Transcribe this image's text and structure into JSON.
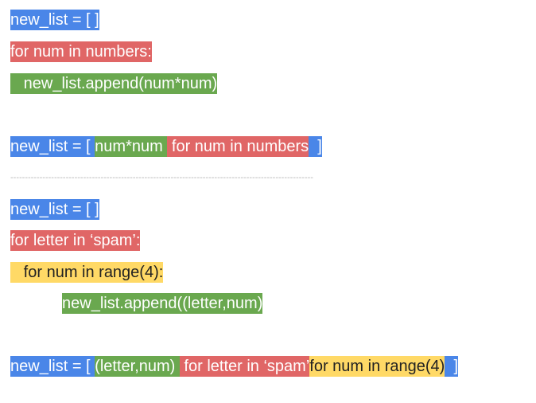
{
  "colors": {
    "blue": "#4a86e8",
    "red": "#e06666",
    "green": "#6aa84f",
    "yellow": "#ffd966"
  },
  "section1": {
    "init": "new_list = [ ]",
    "loop": "for num in numbers:",
    "body": "   new_list.append(num*num)",
    "comp_open": "new_list = [ ",
    "comp_expr": "num*num ",
    "comp_for": " for num in numbers",
    "comp_close": "  ]"
  },
  "divider": "--------------------------------------------------------------------------------------------------------",
  "section2": {
    "init": "new_list = [ ]",
    "outer_loop": "for letter in ‘spam’:",
    "inner_loop": "   for num in range(4):",
    "body": "new_list.append((letter,num)",
    "comp_open": "new_list = [ ",
    "comp_expr": "(letter,num) ",
    "comp_outer": " for letter in ‘spam’",
    "comp_inner": "for num in range(4)",
    "comp_close": "  ]"
  }
}
